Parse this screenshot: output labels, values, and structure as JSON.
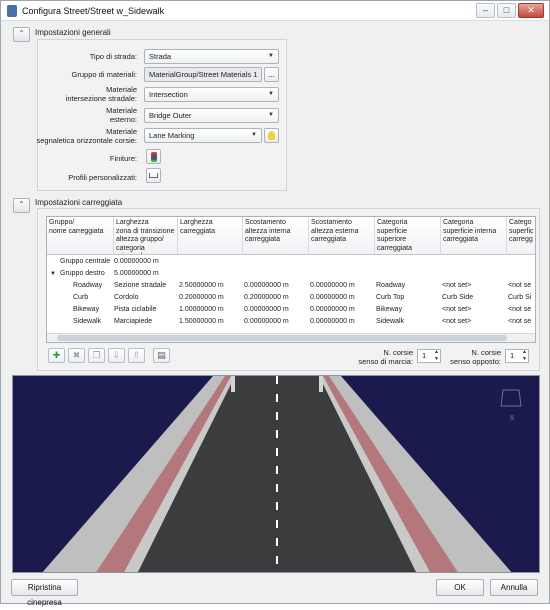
{
  "window": {
    "title": "Configura Street/Street w_Sidewalk"
  },
  "general": {
    "header": "Impostazioni generali",
    "road_type": {
      "label": "Tipo di strada:",
      "value": "Strada"
    },
    "material_group": {
      "label": "Gruppo di materiali:",
      "value": "MaterialGroup/Street Materials 1",
      "browse_label": "..."
    },
    "intersection_material": {
      "label_line1": "Materiale",
      "label_line2": "intersezione stradale:",
      "value": "Intersection"
    },
    "external_material": {
      "label_line1": "Materiale",
      "label_line2": "esterno:",
      "value": "Bridge Outer"
    },
    "marking_material": {
      "label_line1": "Materiale",
      "label_line2": "segnaletica orizzontale corsie:",
      "value": "Lane Marking"
    },
    "finishes": {
      "label": "Finiture:"
    },
    "custom_profiles": {
      "label": "Profili personalizzati:"
    }
  },
  "lanes": {
    "header": "Impostazioni carreggiata",
    "columns": [
      "Gruppo/\nnome carreggiata",
      "Larghezza\nzona di transizione\naltezza gruppo/\ncategoria principale",
      "Larghezza\ncarreggiata",
      "Scostamento\naltezza interna\ncarreggiata",
      "Scostamento\naltezza esterna\ncarreggiata",
      "Categoria\nsuperficie superiore\ncarreggiata",
      "Categoria\nsuperficie interna\ncarreggiata",
      "Catego\nsuperfic\ncarregg"
    ],
    "rows": [
      {
        "c0": "Gruppo centrale",
        "c1": "0.00000000 m",
        "c2": "",
        "c3": "",
        "c4": "",
        "c5": "",
        "c6": "",
        "c7": ""
      },
      {
        "c0": "Gruppo destro",
        "c1": "5.00000000 m",
        "c2": "",
        "c3": "",
        "c4": "",
        "c5": "",
        "c6": "",
        "c7": ""
      },
      {
        "c0": "Roadway",
        "c1": "Sezione stradale",
        "c2": "2.50000000 m",
        "c3": "0.00000000 m",
        "c4": "0.00000000 m",
        "c5": "Roadway",
        "c6": "<not set>",
        "c7": "<not se"
      },
      {
        "c0": "Curb",
        "c1": "Cordolo",
        "c2": "0.20000000 m",
        "c3": "0.20000000 m",
        "c4": "0.00000000 m",
        "c5": "Curb Top",
        "c6": "Curb Side",
        "c7": "Curb Si"
      },
      {
        "c0": "Bikeway",
        "c1": "Pista ciclabile",
        "c2": "1.00000000 m",
        "c3": "0.00000000 m",
        "c4": "0.00000000 m",
        "c5": "Bikeway",
        "c6": "<not set>",
        "c7": "<not se"
      },
      {
        "c0": "Sidewalk",
        "c1": "Marciapiede",
        "c2": "1.50000000 m",
        "c3": "0.00000000 m",
        "c4": "0.00000000 m",
        "c5": "Sidewalk",
        "c6": "<not set>",
        "c7": "<not se"
      }
    ],
    "lanes_forward": {
      "label_line1": "N. corsie",
      "label_line2": "senso di marcia:",
      "value": "1"
    },
    "lanes_opposite": {
      "label_line1": "N. corsie",
      "label_line2": "senso opposto:",
      "value": "1"
    }
  },
  "viewport": {
    "compass_label": "S"
  },
  "footer": {
    "reset_camera": "Ripristina cinepresa",
    "ok": "OK",
    "cancel": "Annulla"
  },
  "colors": {
    "accent_green": "#2f9a3a",
    "road": "#3c3d3f",
    "brick": "#b0787c",
    "sky": "#1b1a4d"
  }
}
